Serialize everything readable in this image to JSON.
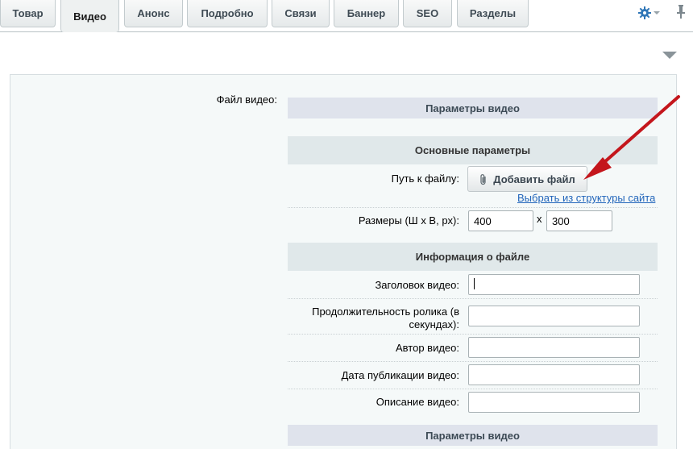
{
  "tabs": [
    {
      "label": "Товар",
      "active": false
    },
    {
      "label": "Видео",
      "active": true
    },
    {
      "label": "Анонс",
      "active": false
    },
    {
      "label": "Подробно",
      "active": false
    },
    {
      "label": "Связи",
      "active": false
    },
    {
      "label": "Баннер",
      "active": false
    },
    {
      "label": "SEO",
      "active": false
    },
    {
      "label": "Разделы",
      "active": false
    }
  ],
  "toolbar": {
    "settings_icon": "gear-icon",
    "pin_icon": "pin-icon"
  },
  "form": {
    "file_label": "Файл видео:",
    "sections": {
      "video_params_top": "Параметры видео",
      "basic_params": "Основные параметры",
      "file_info": "Информация о файле",
      "video_params_bottom": "Параметры видео"
    },
    "path": {
      "label": "Путь к файлу:",
      "button_label": "Добавить файл",
      "link": "Выбрать из структуры сайта"
    },
    "size": {
      "label": "Размеры (Ш х В, px):",
      "width": "400",
      "separator": "х",
      "height": "300"
    },
    "info": {
      "title_label": "Заголовок видео:",
      "title_value": "",
      "duration_label_1": "Продолжительность ролика (в",
      "duration_label_2": "секундах):",
      "duration_value": "",
      "author_label": "Автор видео:",
      "author_value": "",
      "date_label": "Дата публикации видео:",
      "date_value": "",
      "description_label": "Описание видео:",
      "description_value": ""
    }
  },
  "colors": {
    "annotation_arrow": "#c4161c",
    "link": "#2266bb",
    "section_bg": "#e0e8ea"
  }
}
